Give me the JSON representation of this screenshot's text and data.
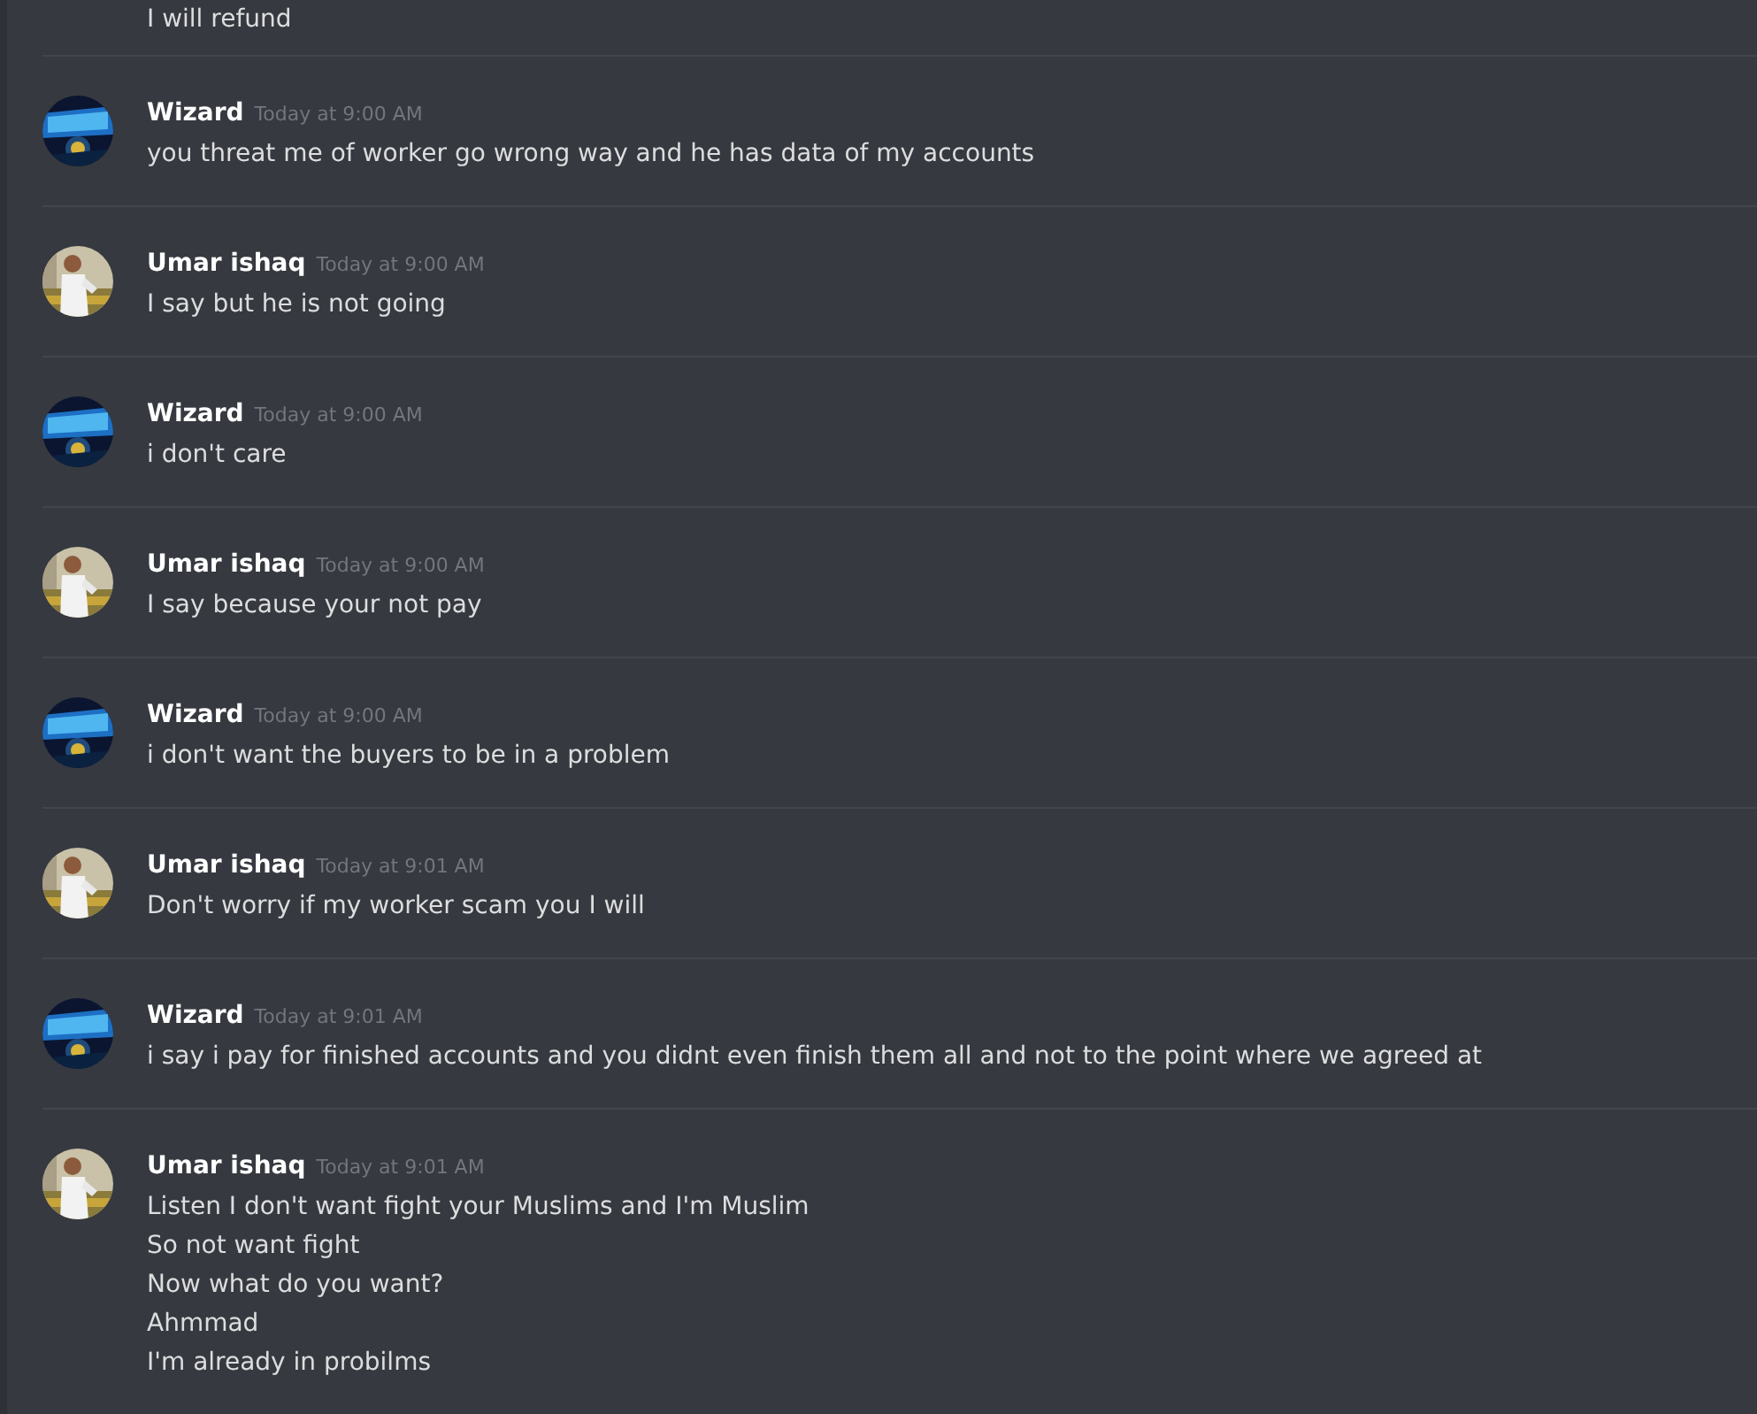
{
  "previous_message": {
    "lines": [
      "I will refund"
    ]
  },
  "messages": [
    {
      "kind": "logo",
      "author": "Wizard",
      "timestamp": "Today at 9:00 AM",
      "lines": [
        "you threat me of worker go wrong way and he has data of my accounts"
      ]
    },
    {
      "author": "Umar ishaq",
      "timestamp": "Today at 9:00 AM",
      "lines": [
        "I say but he is not going"
      ]
    },
    {
      "kind": "logo",
      "author": "Wizard",
      "timestamp": "Today at 9:00 AM",
      "lines": [
        "i don't care"
      ]
    },
    {
      "author": "Umar ishaq",
      "timestamp": "Today at 9:00 AM",
      "lines": [
        "I say because your not pay"
      ]
    },
    {
      "kind": "logo",
      "author": "Wizard",
      "timestamp": "Today at 9:00 AM",
      "lines": [
        "i don't want the buyers to be in a problem"
      ]
    },
    {
      "author": "Umar ishaq",
      "timestamp": "Today at 9:01 AM",
      "lines": [
        "Don't worry if my worker scam you I will"
      ]
    },
    {
      "kind": "logo",
      "author": "Wizard",
      "timestamp": "Today at 9:01 AM",
      "lines": [
        "i say i pay for finished accounts and you didnt even finish them all and not to the point where we agreed at"
      ]
    },
    {
      "author": "Umar ishaq",
      "timestamp": "Today at 9:01 AM",
      "lines": [
        "Listen I don't want fight your Muslims and I'm Muslim",
        "So not want fight",
        "Now what do you want?",
        "Ahmmad",
        "I'm already in probilms"
      ]
    }
  ]
}
